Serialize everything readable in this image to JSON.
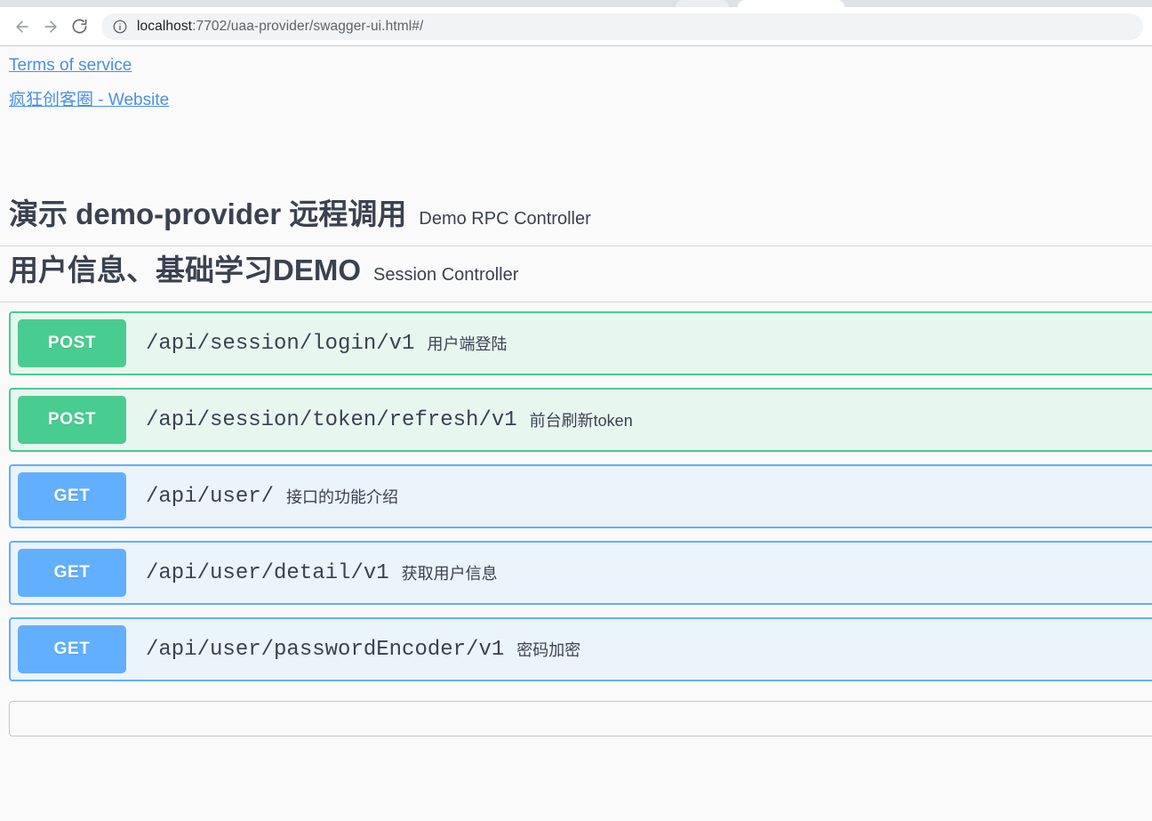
{
  "browser": {
    "back_label": "back-arrow",
    "forward_label": "forward-arrow",
    "reload_label": "reload",
    "url_host": "localhost",
    "url_rest": ":7702/uaa-provider/swagger-ui.html#/",
    "site_info_icon": "info-circle-icon"
  },
  "swagger": {
    "info_links": [
      {
        "label": "Terms of service"
      },
      {
        "label": "疯狂创客圈 - Website"
      }
    ],
    "tags": [
      {
        "title": "演示 demo-provider 远程调用",
        "description": "Demo RPC Controller",
        "operations": []
      },
      {
        "title": "用户信息、基础学习DEMO",
        "description": "Session Controller",
        "operations": [
          {
            "method": "POST",
            "method_class": "post",
            "path": "/api/session/login/v1",
            "summary": "用户端登陆"
          },
          {
            "method": "POST",
            "method_class": "post",
            "path": "/api/session/token/refresh/v1",
            "summary": "前台刷新token"
          },
          {
            "method": "GET",
            "method_class": "get",
            "path": "/api/user/",
            "summary": "接口的功能介绍"
          },
          {
            "method": "GET",
            "method_class": "get",
            "path": "/api/user/detail/v1",
            "summary": "获取用户信息"
          },
          {
            "method": "GET",
            "method_class": "get",
            "path": "/api/user/passwordEncoder/v1",
            "summary": "密码加密"
          }
        ]
      }
    ],
    "colors": {
      "post_badge": "#49cc90",
      "post_bg": "#e8f6f0",
      "get_badge": "#61affe",
      "get_bg": "#ebf3fb",
      "link": "#4990e2",
      "text": "#3b4151"
    }
  }
}
